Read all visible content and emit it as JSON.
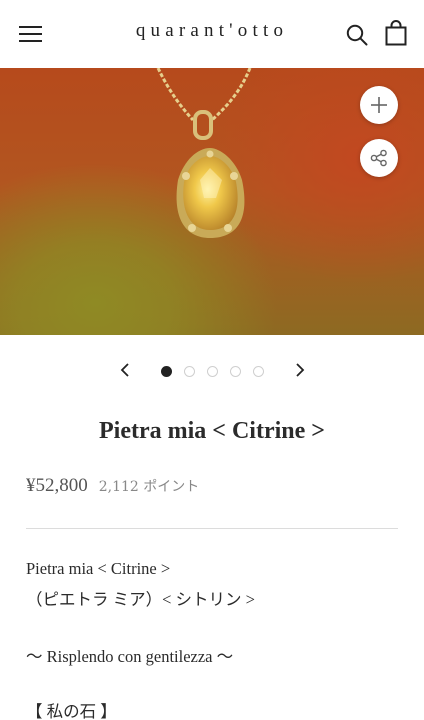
{
  "header": {
    "brand": "quarant'otto",
    "menu_icon": "hamburger-menu-icon",
    "search_icon": "search-icon",
    "bag_icon": "shopping-bag-icon"
  },
  "hero": {
    "alt": "Gold necklace with citrine pendant",
    "zoom_icon": "plus-icon",
    "share_icon": "share-icon"
  },
  "carousel": {
    "prev_icon": "chevron-left-icon",
    "next_icon": "chevron-right-icon",
    "dot_count": 5,
    "active_index": 0
  },
  "product": {
    "title": "Pietra mia < Citrine >",
    "price": "¥52,800",
    "points": "2,112 ポイント"
  },
  "description": {
    "line1": "Pietra mia < Citrine >",
    "line2": "（ピエトラ ミア）< シトリン >",
    "line3": "〜 Risplendo con gentilezza 〜",
    "line4": "【 私の石 】"
  },
  "colors": {
    "text": "#2b2b2b",
    "muted": "#888888",
    "active_dot": "#222222"
  }
}
